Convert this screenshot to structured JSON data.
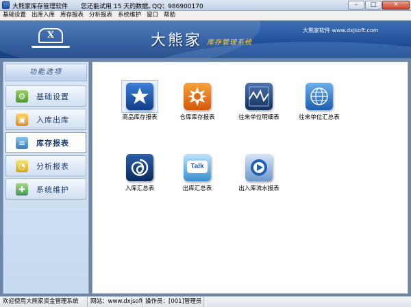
{
  "window": {
    "title": "大熊家库存管理软件",
    "trial_text": "您还能试用 15 天的数据。",
    "qq_text": "QQ：986900170",
    "min_label": "–",
    "max_label": "□",
    "close_label": "✕"
  },
  "menu": {
    "items": [
      "基础设置",
      "出库入库",
      "库存报表",
      "分析报表",
      "系统维护",
      "窗口",
      "帮助"
    ]
  },
  "banner": {
    "logo_letter": "X",
    "brand_name": "大熊家",
    "brand_sub": "库存管理系统",
    "site": "大熊家软件 www.dxjsoft.com"
  },
  "sidebar": {
    "header": "功能选项",
    "items": [
      {
        "label": "基础设置",
        "icon": "gear-icon"
      },
      {
        "label": "入库出库",
        "icon": "box-icon"
      },
      {
        "label": "库存报表",
        "icon": "stack-icon"
      },
      {
        "label": "分析报表",
        "icon": "chart-icon"
      },
      {
        "label": "系统维护",
        "icon": "wrench-icon"
      }
    ],
    "active_index": 2
  },
  "modules": [
    {
      "label": "商品库存报表",
      "icon": "star-icon",
      "color": "#1f5fb8"
    },
    {
      "label": "仓库库存报表",
      "icon": "sun-icon",
      "color": "#e8741e"
    },
    {
      "label": "往来单位明细表",
      "icon": "graph-icon",
      "color": "#2a4f86"
    },
    {
      "label": "往来单位汇总表",
      "icon": "globe-icon",
      "color": "#3a8fd8"
    },
    {
      "label": "入库汇总表",
      "icon": "spiral-icon",
      "color": "#0f3f7d"
    },
    {
      "label": "出库汇总表",
      "icon": "talk-icon",
      "color": "#3a9ad8",
      "icon_text": "Talk"
    },
    {
      "label": "出入库流水报表",
      "icon": "target-icon",
      "color": "#1f5fb8"
    }
  ],
  "status": {
    "welcome": "欢迎使用大熊家资金管理系统",
    "site": "网站：www.dxjsoft.com",
    "operator": "操作员：[001]管理员"
  }
}
